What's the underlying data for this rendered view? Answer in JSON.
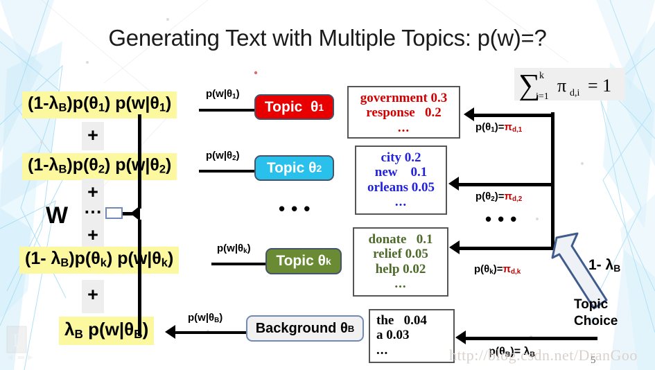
{
  "slide": {
    "title": "Generating Text with Multiple Topics: p(w)=?",
    "page_number": "5",
    "watermark": "http://blog.csdn.net/DranGoo"
  },
  "equations": {
    "constraint": "∑ i=1..k  π d,i  = 1",
    "constraint_sum": "∑",
    "constraint_upper": "k",
    "constraint_lower": "i=1",
    "constraint_pi": "π",
    "constraint_pi_sub": "d,i",
    "constraint_rhs": "= 1"
  },
  "mixture": {
    "w_symbol": "W",
    "ellipsis": "⋯",
    "plus": "+",
    "rows": [
      {
        "id": "row-1",
        "formula_html": "(1-λ<sub>B</sub>)p(θ<sub>1</sub>) p(w|θ<sub>1</sub>)"
      },
      {
        "id": "row-2",
        "formula_html": "(1-λ<sub>B</sub>)p(θ<sub>2</sub>) p(w|θ<sub>2</sub>)"
      },
      {
        "id": "row-k",
        "formula_html": "(1- λ<sub>B</sub>)p(θ<sub>k</sub>) p(w|θ<sub>k</sub>)"
      },
      {
        "id": "row-b",
        "formula_html": "λ<sub>B</sub> p(w|θ<sub>B</sub>)"
      }
    ]
  },
  "edge_labels": [
    {
      "id": "edge-1",
      "html": "p(w|θ<sub>1</sub>)"
    },
    {
      "id": "edge-2",
      "html": "p(w|θ<sub>2</sub>)"
    },
    {
      "id": "edge-k",
      "html": "p(w|θ<sub>k</sub>)"
    },
    {
      "id": "edge-b",
      "html": "p(w|θ<sub>B</sub>)"
    }
  ],
  "topics": [
    {
      "id": "topic-1",
      "label_html": "Topic&nbsp; θ<sub>1</sub>",
      "color": "#e80000",
      "text_color": "#ffffff"
    },
    {
      "id": "topic-2",
      "label_html": "Topic θ<sub>2</sub>",
      "color": "#29c0ec",
      "text_color": "#ffffff"
    },
    {
      "id": "topic-k",
      "label_html": "Topic θ<sub>k</sub>",
      "color": "#6a8a33",
      "text_color": "#ffffff"
    },
    {
      "id": "topic-background",
      "label_html": "Background θ<sub>B</sub>",
      "color": "#f1f1f1",
      "text_color": "#000000"
    }
  ],
  "word_distributions": [
    {
      "id": "words-topic-1",
      "color": "#d00000",
      "entries": [
        {
          "word": "government",
          "prob": "0.3"
        },
        {
          "word": "response",
          "prob": "0.2"
        }
      ],
      "ellipsis": "..."
    },
    {
      "id": "words-topic-2",
      "color": "#2222dd",
      "entries": [
        {
          "word": "city",
          "prob": "0.2"
        },
        {
          "word": "new",
          "prob": "0.1"
        },
        {
          "word": "orleans",
          "prob": "0.05"
        }
      ],
      "ellipsis": "..."
    },
    {
      "id": "words-topic-k",
      "color": "#4d6a2a",
      "entries": [
        {
          "word": "donate",
          "prob": "0.1"
        },
        {
          "word": "relief",
          "prob": "0.05"
        },
        {
          "word": "help",
          "prob": "0.02"
        }
      ],
      "ellipsis": "..."
    },
    {
      "id": "words-background",
      "color": "#000000",
      "entries": [
        {
          "word": "the",
          "prob": "0.04"
        },
        {
          "word": "a",
          "prob": "0.03"
        }
      ],
      "ellipsis": "..."
    }
  ],
  "pi_labels": [
    {
      "id": "pi-1",
      "prefix": "p(θ",
      "sub": "1",
      "mid": ")=",
      "pi": "π",
      "pi_sub": "d,1"
    },
    {
      "id": "pi-2",
      "prefix": "p(θ",
      "sub": "2",
      "mid": ")=",
      "pi": "π",
      "pi_sub": "d,2"
    },
    {
      "id": "pi-k",
      "prefix": "p(θ",
      "sub": "k",
      "mid": ")=",
      "pi": "π",
      "pi_sub": "d,k"
    },
    {
      "id": "pi-b",
      "prefix": "p(θ",
      "sub": "B",
      "mid": ")= ",
      "pi": "λ",
      "pi_sub": "B"
    }
  ],
  "right_ellipsis": "•••",
  "middle_ellipsis": "•••",
  "topic_choice": {
    "lambda_label_html": "1- λ<sub>B</sub>",
    "caption_line1": "Topic",
    "caption_line2": "Choice",
    "arrow_fill": "#eef1f6",
    "arrow_stroke": "#3f5c8c"
  },
  "colors": {
    "highlight": "#fbf8a0",
    "plus_bg": "#eeeeee",
    "line": "#000000",
    "deco_blue": "#7ec9ef",
    "pi_red": "#c00000"
  }
}
